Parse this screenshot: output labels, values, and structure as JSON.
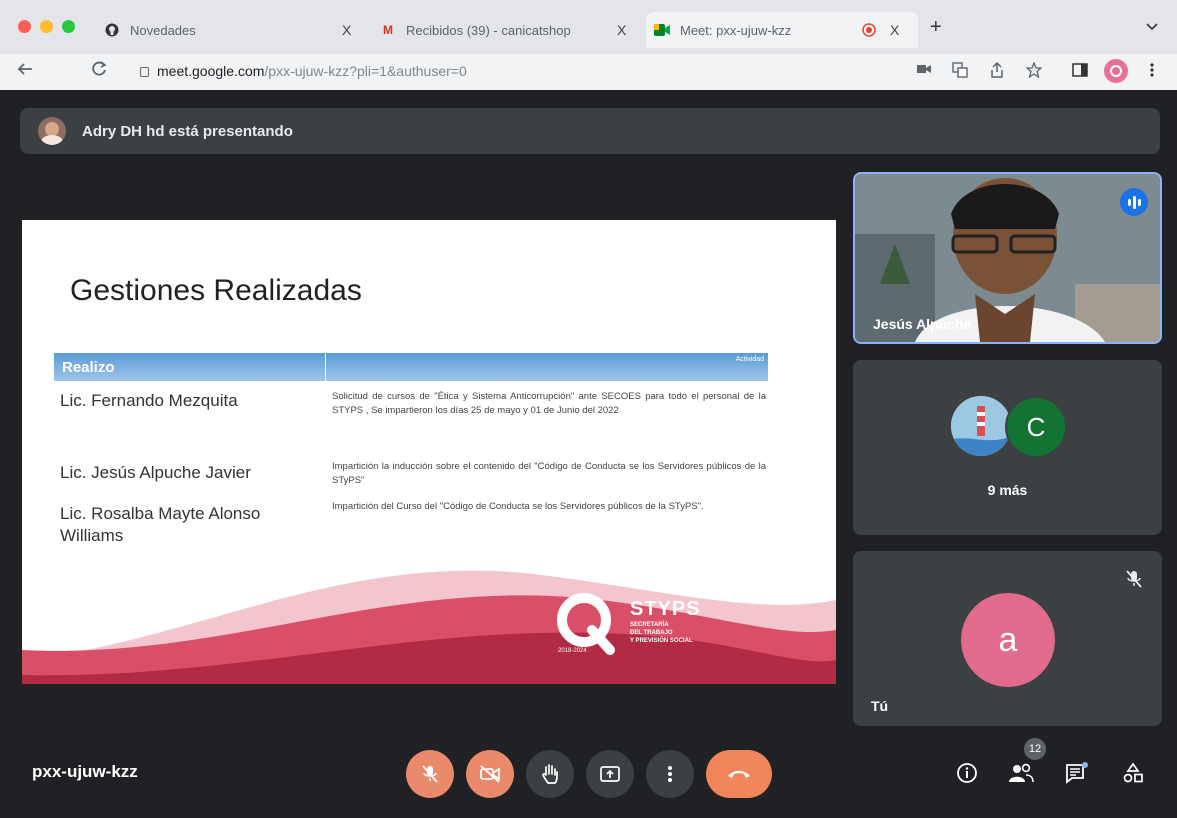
{
  "browser": {
    "tabs": [
      {
        "title": "Novedades"
      },
      {
        "title": "Recibidos (39) - canicatshop"
      },
      {
        "title": "Meet: pxx-ujuw-kzz"
      }
    ],
    "close_glyph": "X",
    "new_tab_glyph": "+",
    "url_host": "meet.google.com",
    "url_path": "/pxx-ujuw-kzz?pli=1&authuser=0"
  },
  "meet": {
    "presenter_banner": "Adry DH hd está presentando",
    "slide": {
      "title": "Gestiones Realizadas",
      "header_col1": "Realizo",
      "header_col2": "Actividad",
      "rows": [
        {
          "name": "Lic. Fernando Mezquita",
          "activity": "Solicitud de cursos de \"Ética y Sistema Anticorrupción\" ante SECOES para todo el personal de la STYPS , Se impartieron los días 25 de mayo y 01 de Junio del 2022"
        },
        {
          "name": "Lic. Jesús Alpuche Javier",
          "activity": "Impartición la inducción sobre el contenido del \"Código de Conducta se los Servidores públicos de la STyPS\""
        },
        {
          "name": "Lic. Rosalba Mayte Alonso Williams",
          "activity": "Impartición del Curso del \"Código de Conducta se los Servidores públicos de la STyPS\"."
        }
      ],
      "brand": "STYPS",
      "brand_sub1": "SECRETARÍA",
      "brand_sub2": "DEL TRABAJO",
      "brand_sub3": "Y PREVISIÓN SOCIAL",
      "brand_years": "2018-2024"
    },
    "tiles": {
      "speaker_name": "Jesús Alpuche",
      "more_avatar_letter": "C",
      "more_label": "9 más",
      "you_letter": "a",
      "you_label": "Tú"
    },
    "meeting_code": "pxx-ujuw-kzz",
    "participants_count": "12"
  },
  "colors": {
    "meet_bg": "#202124",
    "tile_bg": "#3c4043",
    "control_red": "#ea8a6a",
    "avatar_green": "#137333",
    "avatar_pink": "#e16b8c",
    "slide_header_blue": "#5b9bd5",
    "slide_wave_red": "#c8344f"
  }
}
